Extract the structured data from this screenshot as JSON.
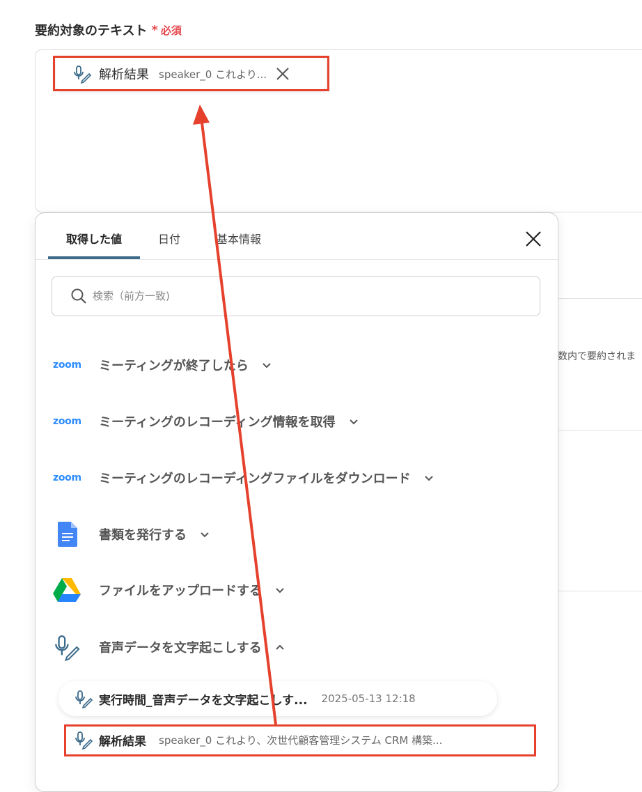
{
  "field": {
    "label": "要約対象のテキスト",
    "required_mark": "*",
    "required_text": "必須"
  },
  "chip": {
    "name": "解析結果",
    "value": "speaker_0 これより...",
    "icon": "mic-pen-icon"
  },
  "background": {
    "partial_text": "数内で要約されま"
  },
  "popup": {
    "tabs": [
      {
        "label": "取得した値",
        "active": true
      },
      {
        "label": "日付",
        "active": false
      },
      {
        "label": "基本情報",
        "active": false
      }
    ],
    "search_placeholder": "検索（前方一致)",
    "groups": [
      {
        "icon": "zoom-logo",
        "logo_text": "zoom",
        "label": "ミーティングが終了したら",
        "expanded": false
      },
      {
        "icon": "zoom-logo",
        "logo_text": "zoom",
        "label": "ミーティングのレコーディング情報を取得",
        "expanded": false
      },
      {
        "icon": "zoom-logo",
        "logo_text": "zoom",
        "label": "ミーティングのレコーディングファイルをダウンロード",
        "expanded": false
      },
      {
        "icon": "google-docs-icon",
        "label": "書類を発行する",
        "expanded": false
      },
      {
        "icon": "google-drive-icon",
        "label": "ファイルをアップロードする",
        "expanded": false
      },
      {
        "icon": "mic-pen-icon",
        "label": "音声データを文字起こしする",
        "expanded": true
      }
    ],
    "items": [
      {
        "name": "実行時間_音声データを文字起こしす...",
        "meta": "2025-05-13 12:18"
      },
      {
        "name": "解析結果",
        "meta": "speaker_0 これより、次世代顧客管理システム CRM 構築..."
      }
    ]
  },
  "colors": {
    "required": "#e5484d",
    "highlight": "#e5412d",
    "zoom": "#2d8cff",
    "tab_indicator": "#3b6a8a"
  }
}
